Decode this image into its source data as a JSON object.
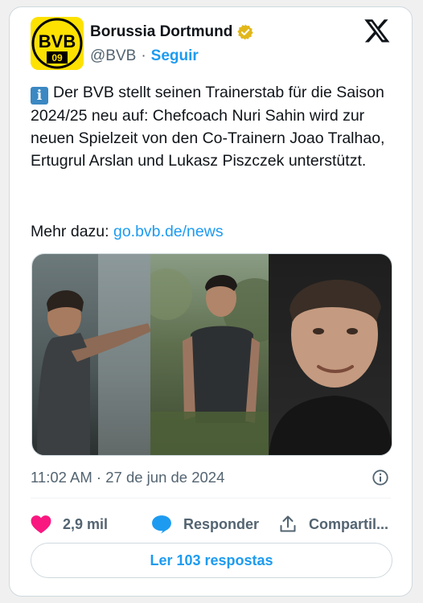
{
  "tweet": {
    "author_name": "Borussia Dortmund",
    "handle": "@BVB",
    "separator": "·",
    "follow_label": "Seguir",
    "logo_text": "BVB",
    "logo_year": "09",
    "text": "Der BVB stellt seinen Trainerstab für die Saison 2024/25 neu auf: Chefcoach Nuri Sahin wird zur neuen Spielzeit von den Co-Trainern Joao Tralhao, Ertugrul Arslan und Lukasz Piszczek unterstützt.",
    "info_emoji": "i",
    "more_label": "Mehr dazu:",
    "link_text": "go.bvb.de/news",
    "timestamp": "11:02 AM · 27 de jun de 2024"
  },
  "actions": {
    "like_count": "2,9 mil",
    "reply_label": "Responder",
    "share_label": "Compartil..."
  },
  "replies_button": "Ler 103 respostas",
  "colors": {
    "accent": "#1d9bf0",
    "like": "#f91880",
    "bvb_yellow": "#fde100",
    "verified_gold": "#e2b719"
  },
  "icons": [
    "bvb-logo",
    "verified-gold-badge",
    "x-logo",
    "info-icon",
    "heart-icon",
    "reply-bubble-icon",
    "share-icon"
  ]
}
